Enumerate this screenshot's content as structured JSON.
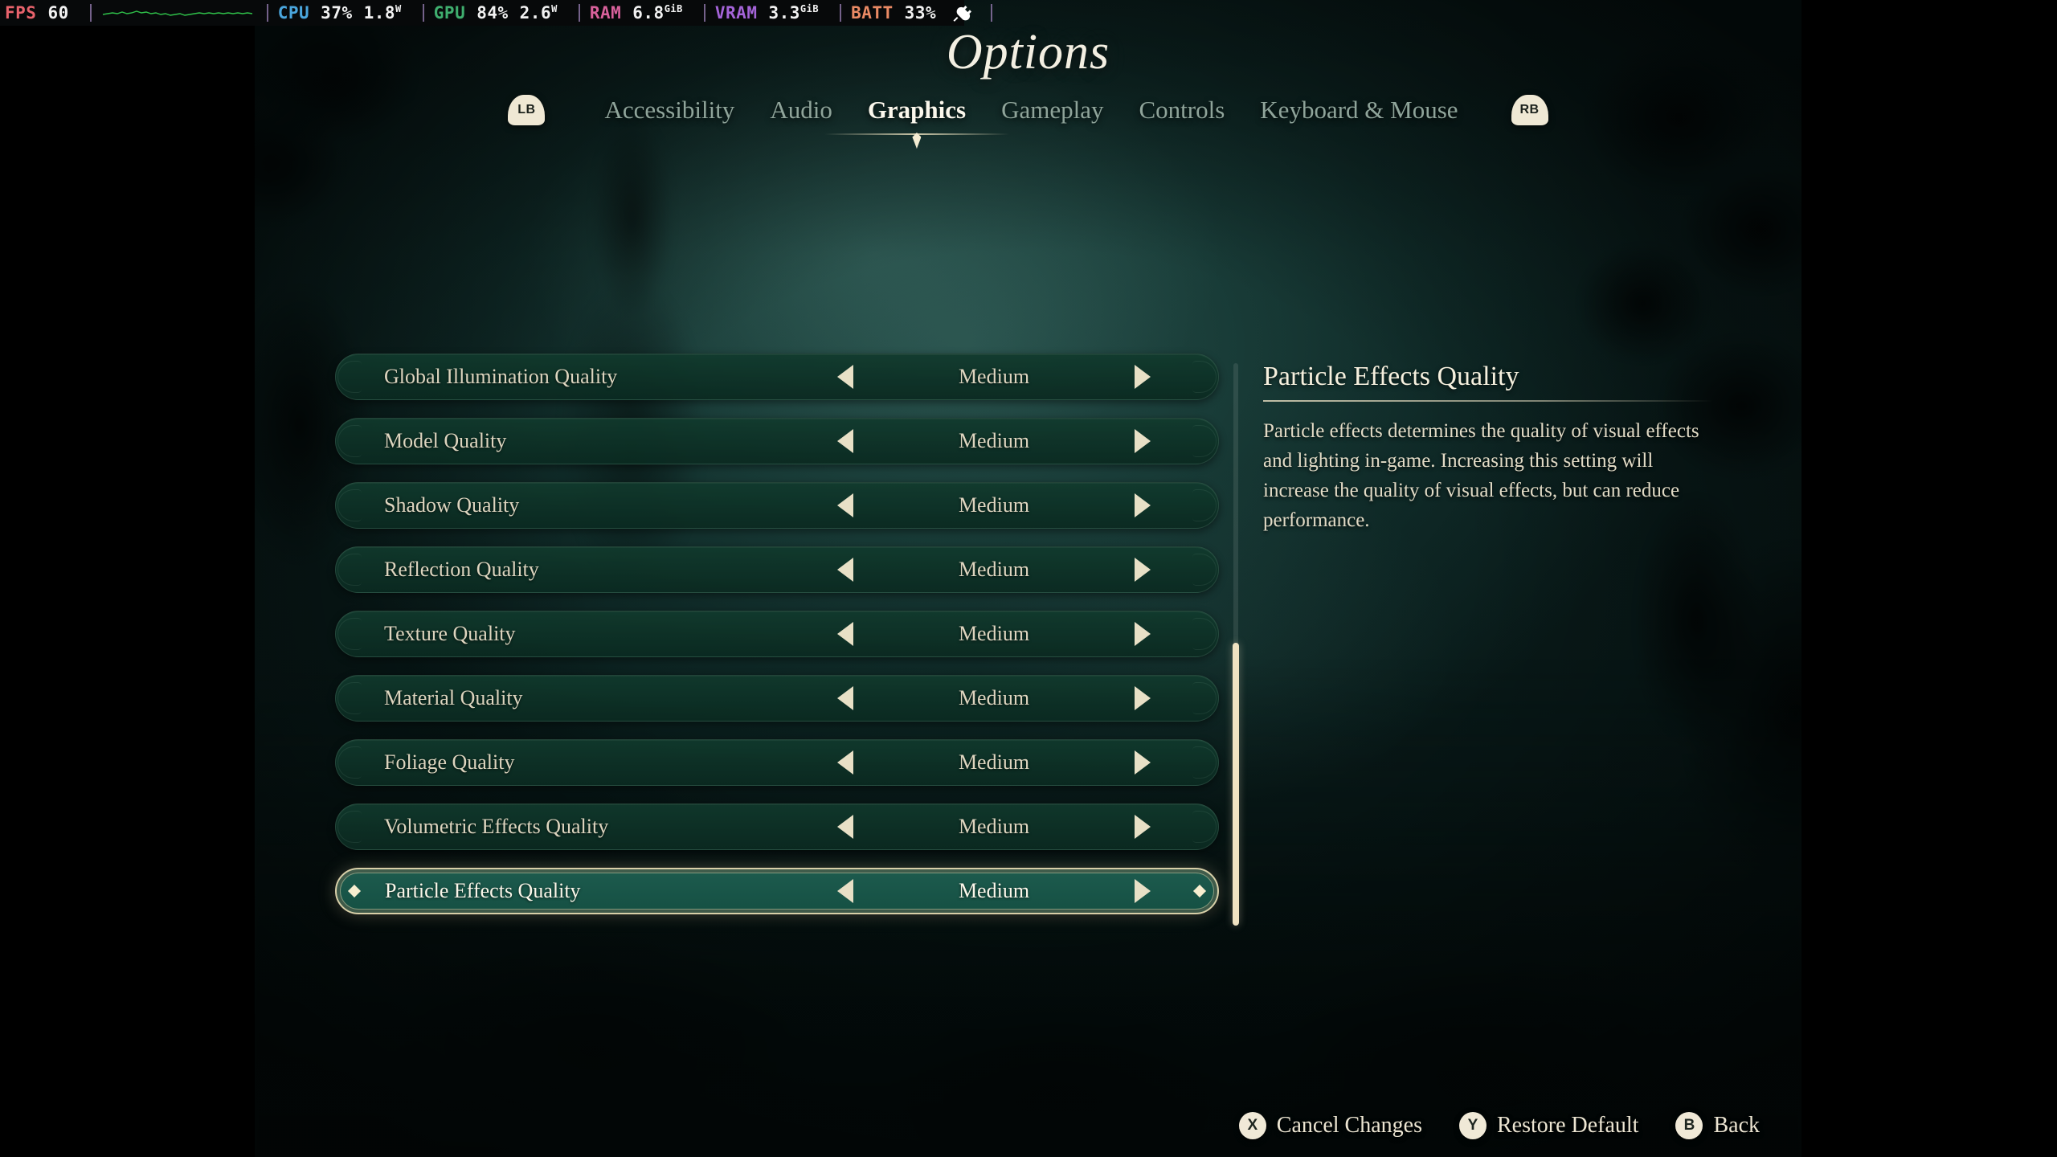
{
  "perf_overlay": {
    "groups": [
      {
        "label": "FPS",
        "color": "#e8636c",
        "values": [
          "60"
        ]
      },
      {
        "label": "CPU",
        "color": "#4aa6dd",
        "values": [
          "37%",
          "1.8"
        ],
        "unit": "W"
      },
      {
        "label": "GPU",
        "color": "#3fae6e",
        "values": [
          "84%",
          "2.6"
        ],
        "unit": "W"
      },
      {
        "label": "RAM",
        "color": "#d8619b",
        "values": [
          "6.8"
        ],
        "unit": "GiB"
      },
      {
        "label": "VRAM",
        "color": "#a464d8",
        "values": [
          "3.3"
        ],
        "unit": "GiB"
      },
      {
        "label": "BATT",
        "color": "#ea8a64",
        "values": [
          "33%"
        ]
      }
    ],
    "fps_label": "FPS",
    "fps_value": "60",
    "cpu_label": "CPU",
    "cpu_pct": "37%",
    "cpu_watts": "1.8",
    "cpu_watts_unit": "W",
    "gpu_label": "GPU",
    "gpu_pct": "84%",
    "gpu_watts": "2.6",
    "gpu_watts_unit": "W",
    "ram_label": "RAM",
    "ram_value": "6.8",
    "ram_unit": "GiB",
    "vram_label": "VRAM",
    "vram_value": "3.3",
    "vram_unit": "GiB",
    "batt_label": "BATT",
    "batt_value": "33%",
    "power_icon": "plug-icon",
    "graph_icon": "fps-sparkline-graph"
  },
  "header": {
    "title": "Options",
    "shoulder_left": "LB",
    "shoulder_right": "RB",
    "tabs": [
      {
        "label": "Accessibility",
        "active": false
      },
      {
        "label": "Audio",
        "active": false
      },
      {
        "label": "Graphics",
        "active": true
      },
      {
        "label": "Gameplay",
        "active": false
      },
      {
        "label": "Controls",
        "active": false
      },
      {
        "label": "Keyboard & Mouse",
        "active": false
      }
    ]
  },
  "settings": {
    "rows": [
      {
        "label": "Global Illumination Quality",
        "value": "Medium",
        "selected": false
      },
      {
        "label": "Model Quality",
        "value": "Medium",
        "selected": false
      },
      {
        "label": "Shadow Quality",
        "value": "Medium",
        "selected": false
      },
      {
        "label": "Reflection Quality",
        "value": "Medium",
        "selected": false
      },
      {
        "label": "Texture Quality",
        "value": "Medium",
        "selected": false
      },
      {
        "label": "Material Quality",
        "value": "Medium",
        "selected": false
      },
      {
        "label": "Foliage Quality",
        "value": "Medium",
        "selected": false
      },
      {
        "label": "Volumetric Effects Quality",
        "value": "Medium",
        "selected": false
      },
      {
        "label": "Particle Effects Quality",
        "value": "Medium",
        "selected": true
      }
    ],
    "scroll_position_pct": 100
  },
  "description": {
    "title": "Particle Effects Quality",
    "body": "Particle effects determines the quality of visual effects and lighting in-game. Increasing this setting will increase the quality of visual effects, but can reduce performance."
  },
  "action_bar": {
    "actions": [
      {
        "button": "X",
        "label": "Cancel Changes"
      },
      {
        "button": "Y",
        "label": "Restore Default"
      },
      {
        "button": "B",
        "label": "Back"
      }
    ]
  },
  "colors": {
    "row_background": "#0d2b22",
    "row_selected_background": "#1a5248",
    "accent_cream": "#e8e0c6",
    "text_muted": "#8fa49a",
    "text_bright": "#fbf7ec",
    "scrollbar_thumb": "#f0e3c2"
  }
}
